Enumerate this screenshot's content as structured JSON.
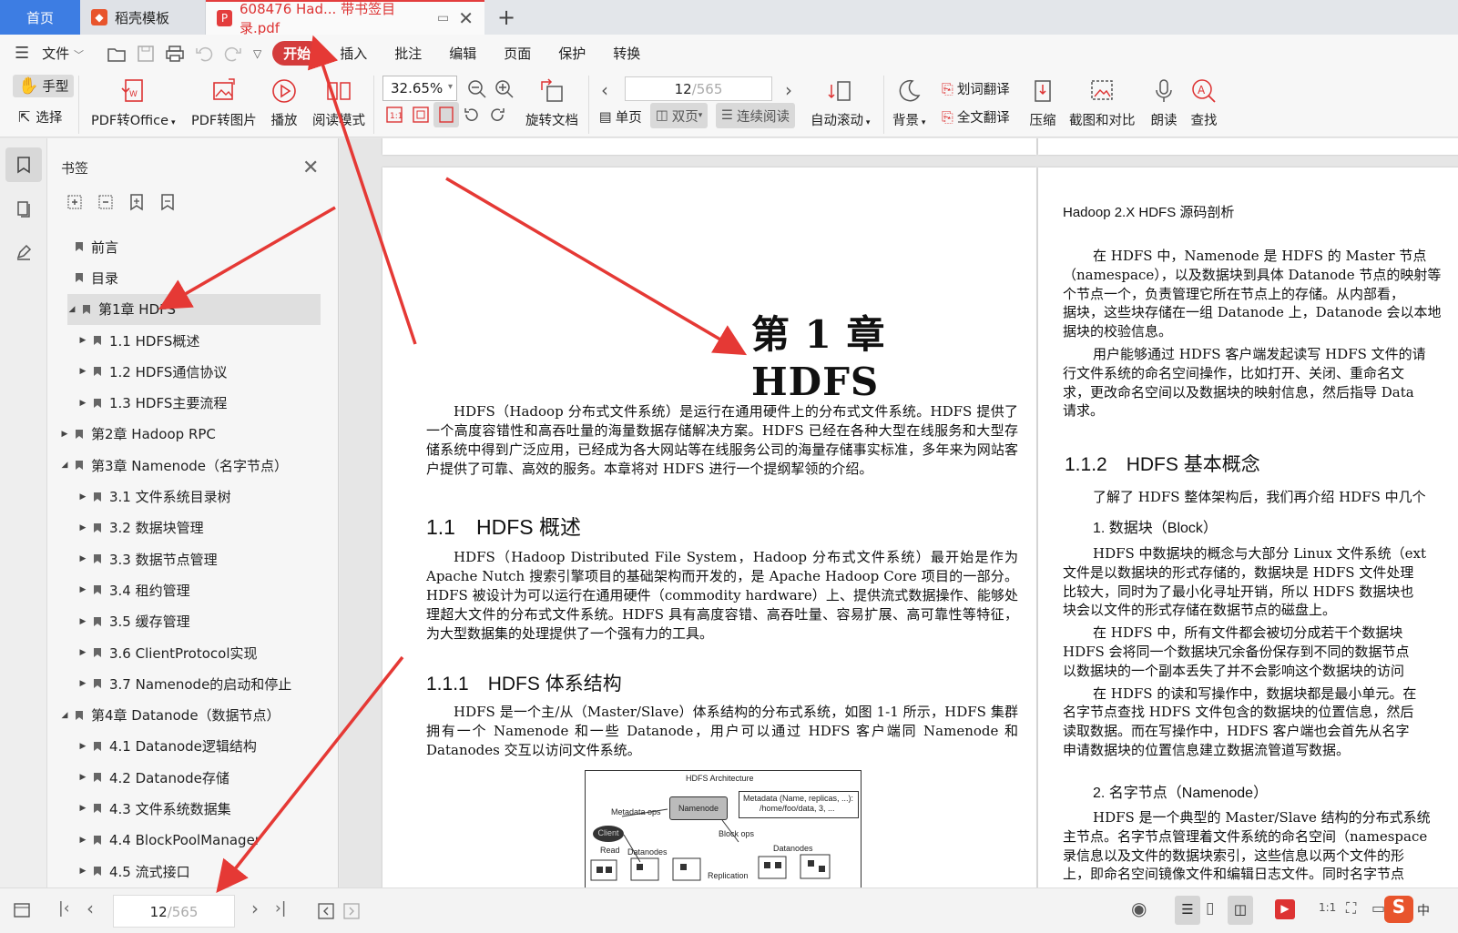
{
  "tabs": {
    "home": "首页",
    "template": "稻壳模板",
    "active_doc": "608476 Had... 带书签目录.pdf"
  },
  "menu": {
    "file": "文件",
    "items": [
      "开始",
      "插入",
      "批注",
      "编辑",
      "页面",
      "保护",
      "转换"
    ]
  },
  "ribbon": {
    "hand": "手型",
    "select": "选择",
    "pdf_to_office": "PDF转Office",
    "pdf_to_image": "PDF转图片",
    "play": "播放",
    "read_mode": "阅读模式",
    "zoom": "32.65%",
    "rotate_doc": "旋转文档",
    "single_page": "单页",
    "double_page": "双页",
    "continuous": "连续阅读",
    "page_current": "12",
    "page_total": "/565",
    "auto_scroll": "自动滚动",
    "background": "背景",
    "word_translate": "划词翻译",
    "full_translate": "全文翻译",
    "compress": "压缩",
    "screenshot_compare": "截图和对比",
    "read_aloud": "朗读",
    "find": "查找"
  },
  "bookmarks": {
    "title": "书签",
    "items": [
      {
        "label": "前言",
        "level": 0,
        "expander": ""
      },
      {
        "label": "目录",
        "level": 0,
        "expander": ""
      },
      {
        "label": "第1章 HDFS",
        "level": 0,
        "expander": "◢",
        "selected": true
      },
      {
        "label": "1.1 HDFS概述",
        "level": 1,
        "expander": "▶"
      },
      {
        "label": "1.2 HDFS通信协议",
        "level": 1,
        "expander": "▶"
      },
      {
        "label": "1.3 HDFS主要流程",
        "level": 1,
        "expander": "▶"
      },
      {
        "label": "第2章 Hadoop RPC",
        "level": 0,
        "expander": "▶"
      },
      {
        "label": "第3章 Namenode（名字节点）",
        "level": 0,
        "expander": "◢"
      },
      {
        "label": "3.1 文件系统目录树",
        "level": 1,
        "expander": "▶"
      },
      {
        "label": "3.2 数据块管理",
        "level": 1,
        "expander": "▶"
      },
      {
        "label": "3.3 数据节点管理",
        "level": 1,
        "expander": "▶"
      },
      {
        "label": "3.4 租约管理",
        "level": 1,
        "expander": "▶"
      },
      {
        "label": "3.5 缓存管理",
        "level": 1,
        "expander": "▶"
      },
      {
        "label": "3.6 ClientProtocol实现",
        "level": 1,
        "expander": "▶"
      },
      {
        "label": "3.7 Namenode的启动和停止",
        "level": 1,
        "expander": "▶"
      },
      {
        "label": "第4章 Datanode（数据节点）",
        "level": 0,
        "expander": "◢"
      },
      {
        "label": "4.1 Datanode逻辑结构",
        "level": 1,
        "expander": "▶"
      },
      {
        "label": "4.2 Datanode存储",
        "level": 1,
        "expander": "▶"
      },
      {
        "label": "4.3 文件系统数据集",
        "level": 1,
        "expander": "▶"
      },
      {
        "label": "4.4 BlockPoolManager",
        "level": 1,
        "expander": "▶"
      },
      {
        "label": "4.5 流式接口",
        "level": 1,
        "expander": "▶"
      }
    ]
  },
  "left_page": {
    "chapter_title": "第 1 章　HDFS",
    "intro": "HDFS（Hadoop 分布式文件系统）是运行在通用硬件上的分布式文件系统。HDFS 提供了一个高度容错性和高吞吐量的海量数据存储解决方案。HDFS 已经在各种大型在线服务和大型存储系统中得到广泛应用，已经成为各大网站等在线服务公司的海量存储事实标准，多年来为网站客户提供了可靠、高效的服务。本章将对 HDFS 进行一个提纲挈领的介绍。",
    "h1": "1.1　HDFS 概述",
    "p1": "HDFS（Hadoop Distributed File System，Hadoop 分布式文件系统）最开始是作为 Apache Nutch 搜索引擎项目的基础架构而开发的，是 Apache Hadoop Core 项目的一部分。HDFS 被设计为可以运行在通用硬件（commodity hardware）上、提供流式数据操作、能够处理超大文件的分布式文件系统。HDFS 具有高度容错、高吞吐量、容易扩展、高可靠性等特征，为大型数据集的处理提供了一个强有力的工具。",
    "h2": "1.1.1　HDFS 体系结构",
    "p2": "HDFS 是一个主/从（Master/Slave）体系结构的分布式系统，如图 1-1 所示，HDFS 集群拥有一个 Namenode 和一些 Datanode，用户可以通过 HDFS 客户端同 Namenode 和 Datanodes 交互以访问文件系统。",
    "figure": {
      "title": "HDFS Architecture",
      "namenode": "Namenode",
      "metadata": "Metadata (Name, replicas, ...):",
      "metadata2": "/home/foo/data, 3, ...",
      "metadata_ops": "Metadata ops",
      "client": "Client",
      "read": "Read",
      "datanodes1": "Datanodes",
      "block_ops": "Block ops",
      "datanodes2": "Datanodes",
      "replication": "Replication"
    }
  },
  "right_page": {
    "header": "Hadoop 2.X HDFS 源码剖析",
    "lines": [
      "在 HDFS 中，Namenode 是 HDFS 的 Master 节点",
      "（namespace），以及数据块到具体 Datanode 节点的映射等",
      "个节点一个，负责管理它所在节点上的存储。从内部看，",
      "据块，这些块存储在一组 Datanode 上，Datanode 会以本地",
      "据块的校验信息。",
      "用户能够通过 HDFS 客户端发起读写 HDFS 文件的请",
      "行文件系统的命名空间操作，比如打开、关闭、重命名文",
      "求，更改命名空间以及数据块的映射信息，然后指导 Data",
      "请求。"
    ],
    "h": "1.1.2　HDFS 基本概念",
    "after_h": "了解了 HDFS 整体架构后，我们再介绍 HDFS 中几个",
    "sub1": "1.  数据块（Block）",
    "block_lines": [
      "HDFS 中数据块的概念与大部分 Linux 文件系统（ext",
      "文件是以数据块的形式存储的，数据块是 HDFS 文件处理",
      "比较大，同时为了最小化寻址开销，所以 HDFS 数据块也",
      "块会以文件的形式存储在数据节点的磁盘上。",
      "在 HDFS 中，所有文件都会被切分成若干个数据块",
      "HDFS 会将同一个数据块冗余备份保存到不同的数据节点",
      "以数据块的一个副本丢失了并不会影响这个数据块的访问",
      "在 HDFS 的读和写操作中，数据块都是最小单元。在",
      "名字节点查找 HDFS 文件包含的数据块的位置信息，然后",
      "读取数据。而在写操作中，HDFS 客户端也会首先从名字",
      "申请数据块的位置信息建立数据流管道写数据。"
    ],
    "sub2": "2.  名字节点（Namenode）",
    "nn_lines": [
      "HDFS 是一个典型的 Master/Slave 结构的分布式系统",
      "主节点。名字节点管理着文件系统的命名空间（namespace",
      "录信息以及文件的数据块索引，这些信息以两个文件的形",
      "上，即命名空间镜像文件和编辑日志文件。同时名字节点"
    ]
  },
  "statusbar": {
    "page_current": "12",
    "page_total": "/565"
  },
  "colors": {
    "accent": "#3d7de3",
    "brand_red": "#d43c3c",
    "annotation_red": "#e53935"
  }
}
